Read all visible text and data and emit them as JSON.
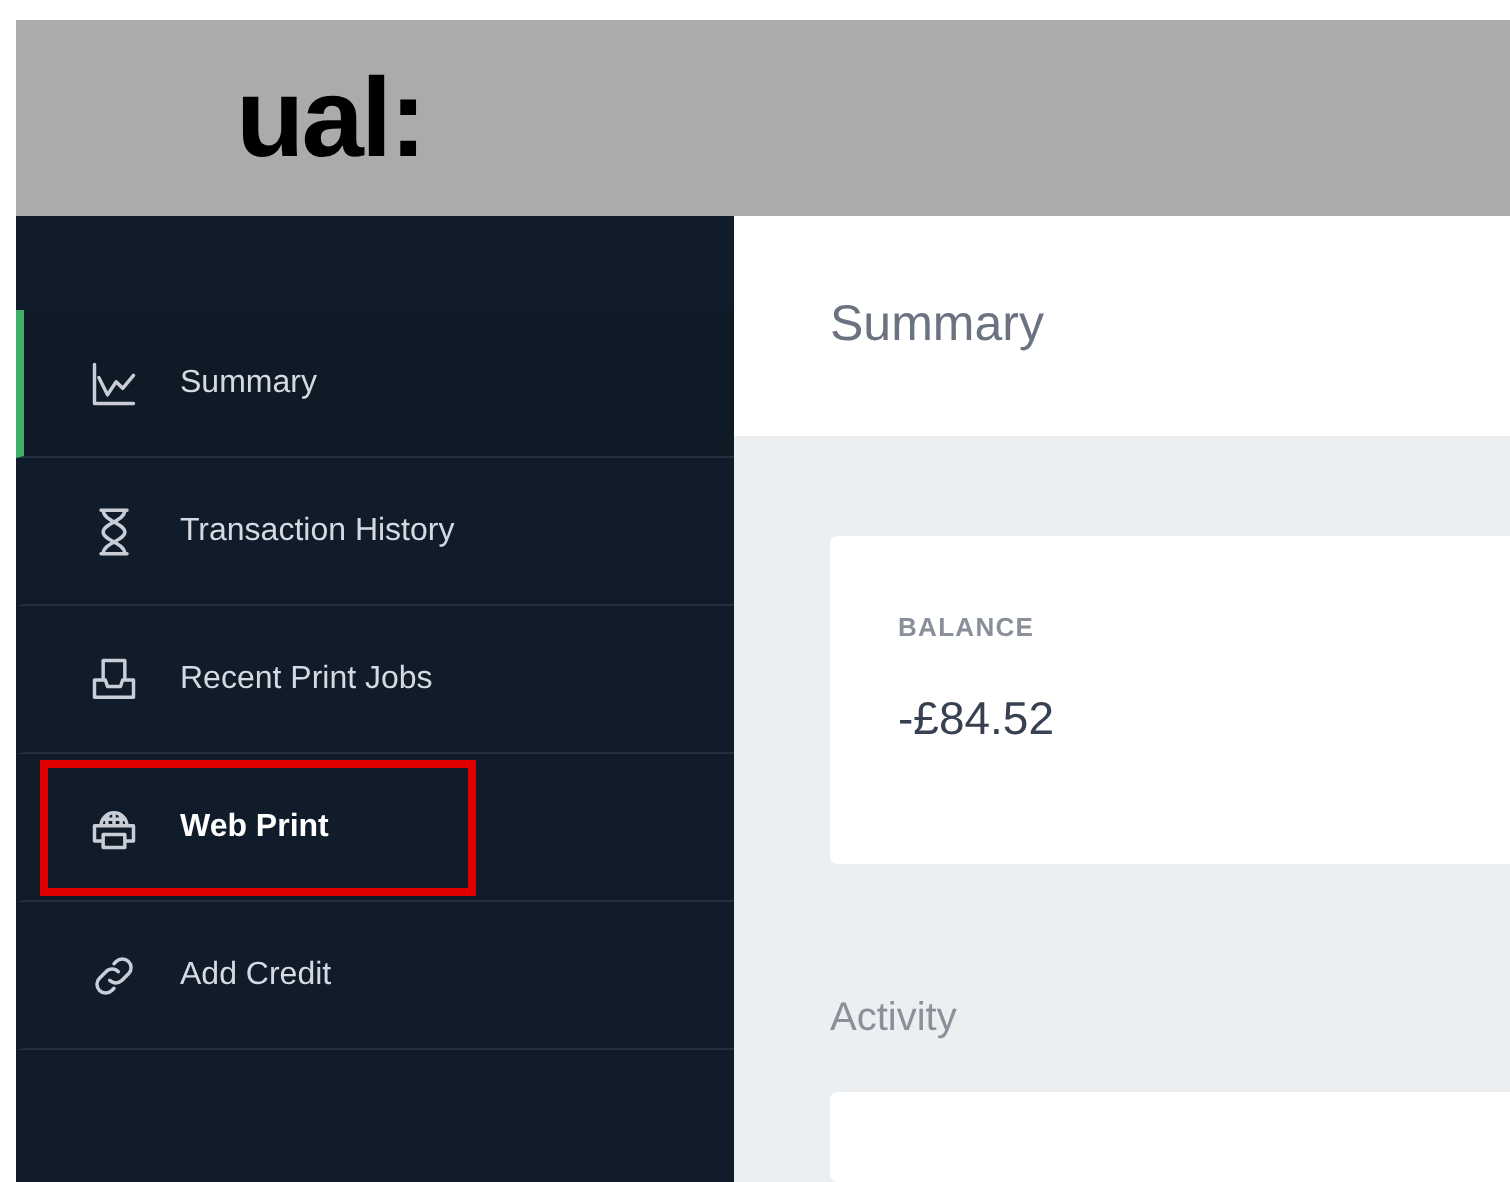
{
  "logo": "ual:",
  "sidebar": {
    "items": [
      {
        "label": "Summary",
        "selected": true,
        "highlighted": false
      },
      {
        "label": "Transaction History",
        "selected": false,
        "highlighted": false
      },
      {
        "label": "Recent Print Jobs",
        "selected": false,
        "highlighted": false
      },
      {
        "label": "Web Print",
        "selected": false,
        "highlighted": true
      },
      {
        "label": "Add Credit",
        "selected": false,
        "highlighted": false
      }
    ]
  },
  "page_title": "Summary",
  "balance": {
    "label": "BALANCE",
    "value": "-£84.52"
  },
  "activity": {
    "title": "Activity"
  }
}
